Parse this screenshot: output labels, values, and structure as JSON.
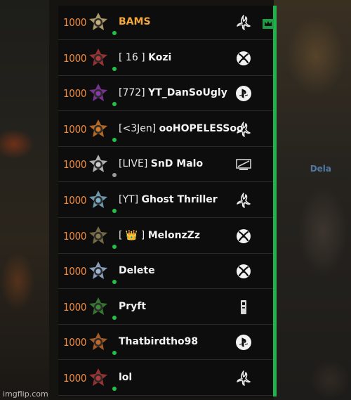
{
  "watermark": "imgflip.com",
  "background_chip": "Dela",
  "colors": {
    "score": "#f08a3d",
    "host_name": "#f3a83b",
    "online": "#22c24a",
    "scrollbar": "#22b24c"
  },
  "players": [
    {
      "score": "1000",
      "tag": "",
      "name": "BAMS",
      "platform": "battlenet-icon",
      "online": true,
      "host": true
    },
    {
      "score": "1000",
      "tag": "[ 16 ]",
      "name": "Kozi",
      "platform": "xbox-icon",
      "online": true
    },
    {
      "score": "1000",
      "tag": "[772]",
      "name": "YT_DanSoUgly",
      "platform": "playstation-icon",
      "online": true
    },
    {
      "score": "1000",
      "tag": "[<3Jen]",
      "name": "ooHOPELESSoo",
      "platform": "battlenet-icon",
      "online": true
    },
    {
      "score": "1000",
      "tag": "[LIVE]",
      "name": "SnD Malo",
      "platform": "pc-icon",
      "online": false
    },
    {
      "score": "1000",
      "tag": "[YT]",
      "name": "Ghost Thriller",
      "platform": "battlenet-icon",
      "online": true
    },
    {
      "score": "1000",
      "tag": "[ 👑 ]",
      "name": "MelonzZz",
      "platform": "xbox-icon",
      "online": true
    },
    {
      "score": "1000",
      "tag": "",
      "name": "Delete",
      "platform": "xbox-icon",
      "online": true
    },
    {
      "score": "1000",
      "tag": "",
      "name": "Pryft",
      "platform": "remote-icon",
      "online": true
    },
    {
      "score": "1000",
      "tag": "",
      "name": "Thatbirdtho98",
      "platform": "playstation-icon",
      "online": true
    },
    {
      "score": "1000",
      "tag": "",
      "name": "lol",
      "platform": "battlenet-icon",
      "online": true
    }
  ]
}
